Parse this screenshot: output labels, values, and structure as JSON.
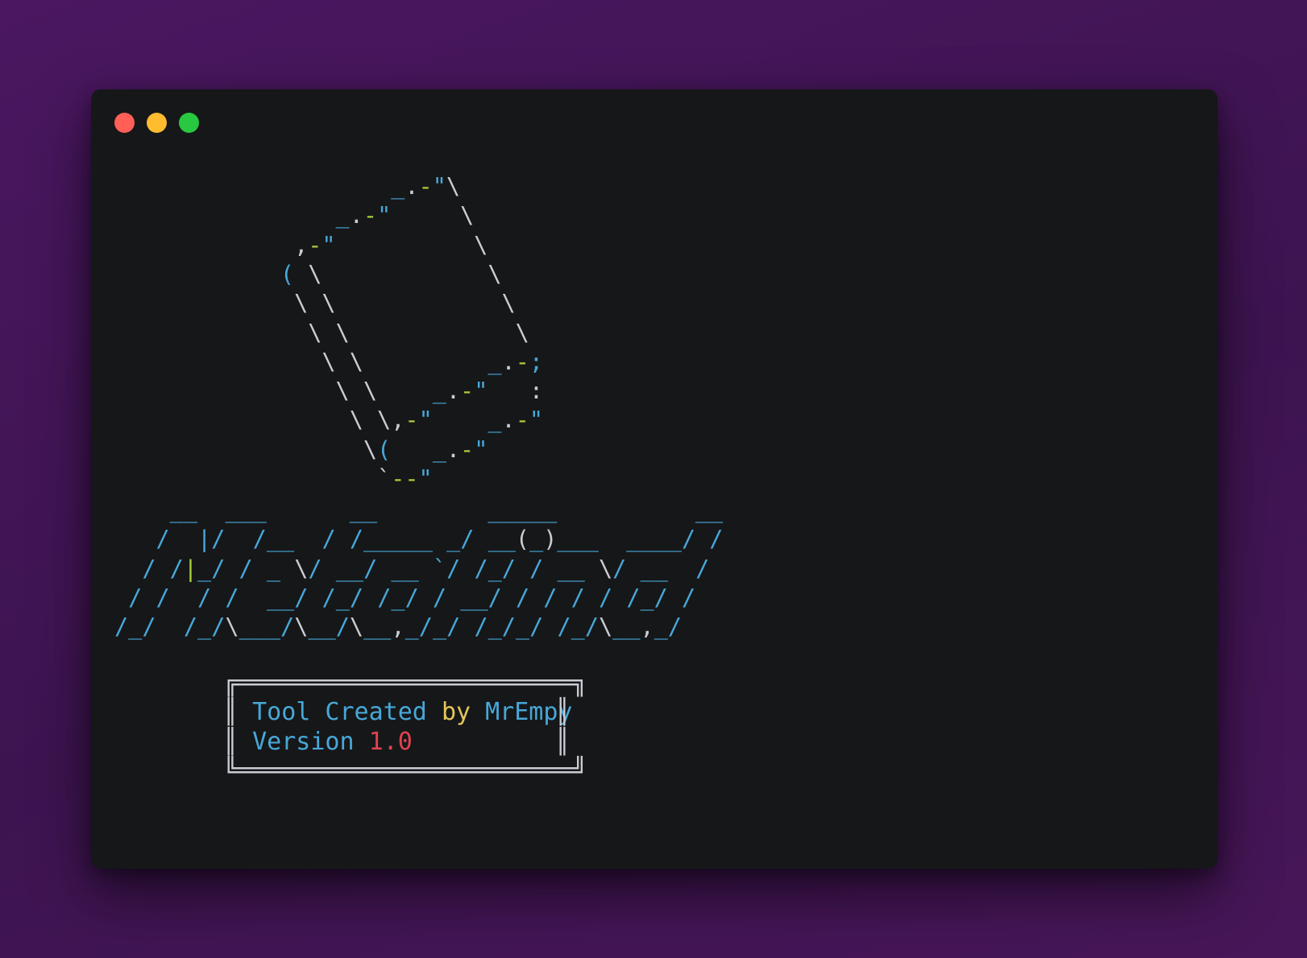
{
  "window": {
    "controls": {
      "close_icon": "close-dot-icon",
      "minimize_icon": "minimize-dot-icon",
      "maximize_icon": "maximize-dot-icon",
      "close_color": "#ff5f57",
      "minimize_color": "#febc2e",
      "maximize_color": "#28c840"
    }
  },
  "terminal": {
    "colors": {
      "white": "#c9cdd3",
      "blue": "#47a8d8",
      "green": "#a6cc3a",
      "yellow": "#e5c45a",
      "red": "#e0434e",
      "background": "#161719",
      "page_background": "#4a1760"
    },
    "laptop_art": [
      "                    _.-\"\\",
      "                _.-\"     \\",
      "             ,-\"          \\",
      "            ( \\            \\",
      "             \\ \\            \\",
      "              \\ \\            \\",
      "               \\ \\         _.-;",
      "                \\ \\    _.-\"   :",
      "                 \\ \\,-\"    _.-\"",
      "                  \\(   _.-\"",
      "                   `--\""
    ],
    "title_art": [
      "    __  ___      __        _____          __",
      "   /  |/  /__  / /_____ _/ __(_)___  ____/ /",
      "  / /|_/ / _ \\/ __/ __ `/ /_/ / __ \\/ __  /",
      " / /  / /  __/ /_/ /_/ / __/ / / / / /_/ /",
      "/_/  /_/\\___/\\__/\\__,_/_/ /_/_/ /_/\\__,_/"
    ],
    "box": {
      "top_border": "╔═══════════════════════╗",
      "bottom_border": "╚═══════════════════════╝",
      "side_border": "║",
      "line1_word1": "Tool Created",
      "line1_word2": "by",
      "line1_word3": "MrEmpy",
      "line2_word1": "Version",
      "line2_word2": "1.0"
    }
  }
}
